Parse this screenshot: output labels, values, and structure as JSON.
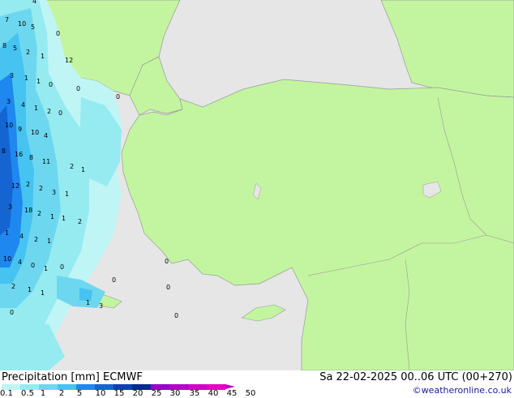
{
  "map": {
    "colors": {
      "sea": "#e6e6e6",
      "land": "#c3f5a0",
      "border": "#999999"
    },
    "labels": [
      {
        "text": "4"
      },
      {
        "text": "7"
      },
      {
        "text": "10"
      },
      {
        "text": "5"
      },
      {
        "text": "0"
      },
      {
        "text": "8"
      },
      {
        "text": "5"
      },
      {
        "text": "2"
      },
      {
        "text": "1"
      },
      {
        "text": "12"
      },
      {
        "text": "3"
      },
      {
        "text": "1"
      },
      {
        "text": "1"
      },
      {
        "text": "0"
      },
      {
        "text": "3"
      },
      {
        "text": "4"
      },
      {
        "text": "1"
      },
      {
        "text": "2"
      },
      {
        "text": "0"
      },
      {
        "text": "10"
      },
      {
        "text": "9"
      },
      {
        "text": "10"
      },
      {
        "text": "4"
      },
      {
        "text": "8"
      },
      {
        "text": "16"
      },
      {
        "text": "8"
      },
      {
        "text": "11"
      },
      {
        "text": "2"
      },
      {
        "text": "1"
      },
      {
        "text": "12"
      },
      {
        "text": "2"
      },
      {
        "text": "2"
      },
      {
        "text": "3"
      },
      {
        "text": "1"
      },
      {
        "text": "3"
      },
      {
        "text": "18"
      },
      {
        "text": "2"
      },
      {
        "text": "1"
      },
      {
        "text": "1"
      },
      {
        "text": "2"
      },
      {
        "text": "1"
      },
      {
        "text": "4"
      },
      {
        "text": "2"
      },
      {
        "text": "1"
      },
      {
        "text": "10"
      },
      {
        "text": "4"
      },
      {
        "text": "0"
      },
      {
        "text": "1"
      },
      {
        "text": "2"
      },
      {
        "text": "1"
      },
      {
        "text": "1"
      },
      {
        "text": "1"
      },
      {
        "text": "3"
      },
      {
        "text": "0"
      },
      {
        "text": "0"
      },
      {
        "text": "0"
      },
      {
        "text": "0"
      },
      {
        "text": "0"
      },
      {
        "text": "0"
      },
      {
        "text": "0"
      },
      {
        "text": "0"
      }
    ]
  },
  "legend": {
    "title": "Precipitation [mm] ECMWF",
    "datetime": "Sa 22-02-2025 00..06 UTC (00+270)",
    "credit": "©weatheronline.co.uk",
    "ticks": [
      "0.1",
      "0.5",
      "1",
      "2",
      "5",
      "10",
      "15",
      "20",
      "25",
      "30",
      "35",
      "40",
      "45",
      "50"
    ],
    "colors": [
      "#bff5f5",
      "#96ebf0",
      "#6ed7f0",
      "#46c3f0",
      "#1e87f0",
      "#1464d2",
      "#0a41b4",
      "#002896",
      "#9600c8",
      "#b400c8",
      "#d200c8",
      "#e600c8",
      "#c000c0"
    ]
  }
}
